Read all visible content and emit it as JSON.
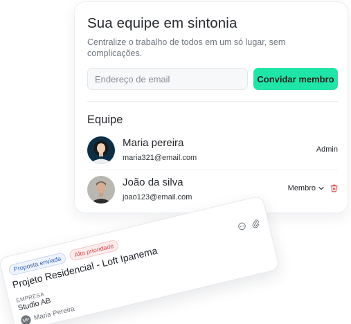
{
  "team_card": {
    "title": "Sua equipe em sintonia",
    "subtitle": "Centralize o trabalho de todos em um só lugar, sem complicações.",
    "email_placeholder": "Endereço de email",
    "invite_label": "Convidar membro",
    "section_title": "Equipe",
    "members": [
      {
        "name": "Maria pereira",
        "email": "maria321@email.com",
        "role": "Admin"
      },
      {
        "name": "João da silva",
        "email": "joao123@email.com",
        "role": "Membro"
      }
    ]
  },
  "project_card": {
    "status_tag": "Proposta enviada",
    "priority_tag": "Alta prioridade",
    "title": "Projeto Residencial - Loft Ipanema",
    "company_label": "EMPRESA",
    "company": "Studio AB",
    "owner_initials": "MP",
    "owner_name": "Maria Pereira"
  },
  "colors": {
    "accent": "#1fe6a6",
    "danger": "#e0484d",
    "status_blue": "#3a63b8"
  },
  "icons": {
    "role_dropdown": "chevron-down-icon",
    "remove_member": "trash-icon",
    "comments": "chat-icon",
    "attachments": "paperclip-icon"
  }
}
